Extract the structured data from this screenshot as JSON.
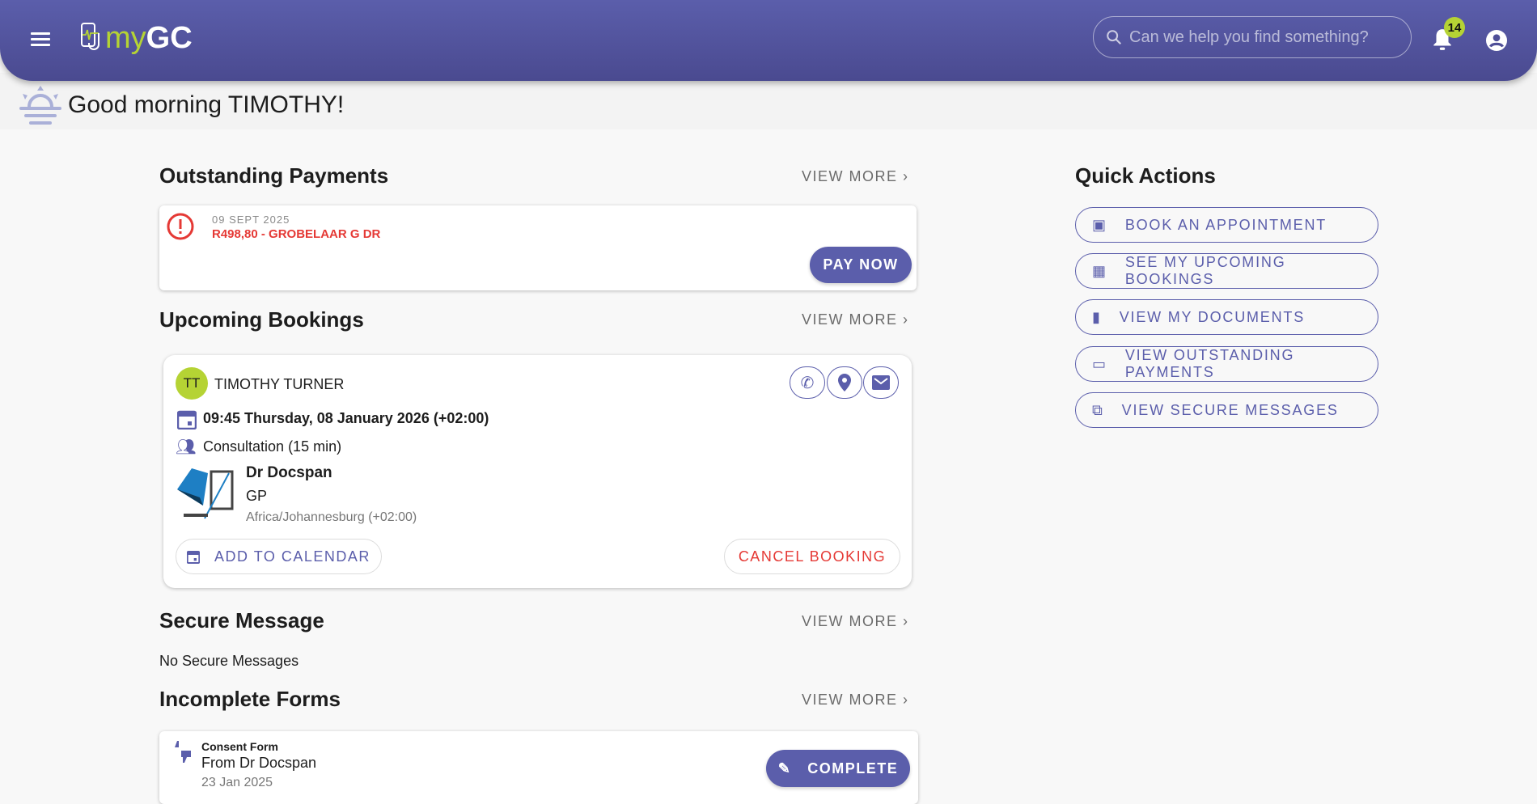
{
  "header": {
    "logo_my": "my",
    "logo_gc": "GC",
    "search_placeholder": "Can we help you find something?",
    "notification_count": "14"
  },
  "greeting": "Good morning TIMOTHY!",
  "outstanding": {
    "title": "Outstanding Payments",
    "view_more": "VIEW MORE",
    "date": "09 SEPT 2025",
    "description": "R498,80 - GROBELAAR G DR",
    "pay_label": "PAY NOW"
  },
  "bookings": {
    "title": "Upcoming Bookings",
    "view_more": "VIEW MORE",
    "initials": "TT",
    "patient": "TIMOTHY TURNER",
    "datetime": "09:45 Thursday, 08 January 2026 (+02:00)",
    "type": "Consultation (15 min)",
    "doctor": "Dr Docspan",
    "specialty": "GP",
    "timezone": "Africa/Johannesburg (+02:00)",
    "add_calendar": "ADD TO CALENDAR",
    "cancel": "CANCEL BOOKING"
  },
  "secure": {
    "title": "Secure Message",
    "view_more": "VIEW MORE",
    "empty": "No Secure Messages"
  },
  "forms": {
    "title": "Incomplete Forms",
    "view_more": "VIEW MORE",
    "name": "Consent Form",
    "from": "From Dr Docspan",
    "date": "23 Jan 2025",
    "complete": "COMPLETE"
  },
  "quick_actions": {
    "title": "Quick Actions",
    "items": [
      {
        "label": "BOOK AN APPOINTMENT",
        "icon": "calendar-icon"
      },
      {
        "label": "SEE MY UPCOMING BOOKINGS",
        "icon": "calendar-grid-icon"
      },
      {
        "label": "VIEW MY DOCUMENTS",
        "icon": "document-icon"
      },
      {
        "label": "VIEW OUTSTANDING PAYMENTS",
        "icon": "credit-card-icon"
      },
      {
        "label": "VIEW SECURE MESSAGES",
        "icon": "chat-icon"
      }
    ]
  },
  "colors": {
    "primary": "#5b5eab",
    "accent": "#b5d334",
    "danger": "#e53935"
  }
}
